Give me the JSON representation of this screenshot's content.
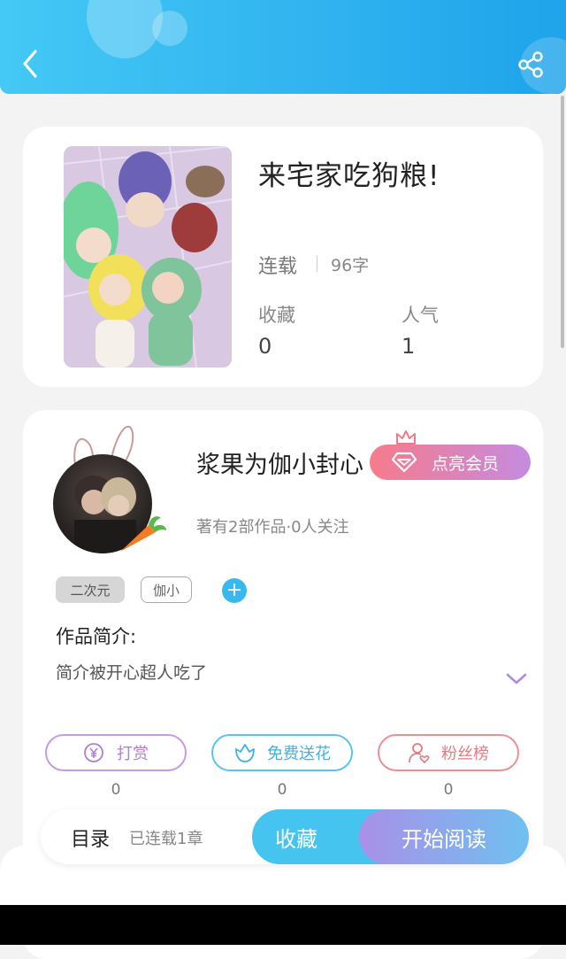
{
  "header": {
    "back_icon": "chevron-left-icon",
    "share_icon": "share-icon",
    "background": "#2fb2ef"
  },
  "book": {
    "title": "来宅家吃狗粮!",
    "status": "连载",
    "word_count": "96字",
    "favorites_label": "收藏",
    "favorites_value": "0",
    "popularity_label": "人气",
    "popularity_value": "1"
  },
  "author": {
    "name": "浆果为伽小封心",
    "vip_button": "点亮会员",
    "meta": "著有2部作品·0人关注",
    "tags": [
      "二次元",
      "伽小"
    ],
    "add_tag": "+",
    "intro_label": "作品简介:",
    "intro_text": "简介被开心超人吃了"
  },
  "actions": [
    {
      "label": "打赏",
      "count": "0",
      "icon": "yen-coin-icon",
      "color": "#b07fd3"
    },
    {
      "label": "免费送花",
      "count": "0",
      "icon": "flower-icon",
      "color": "#3bb2e6"
    },
    {
      "label": "粉丝榜",
      "count": "0",
      "icon": "user-heart-icon",
      "color": "#e37b83"
    }
  ],
  "bottom_bar": {
    "toc_label": "目录",
    "chapters": "已连载1章",
    "collect_button": "收藏",
    "read_button": "开始阅读"
  }
}
